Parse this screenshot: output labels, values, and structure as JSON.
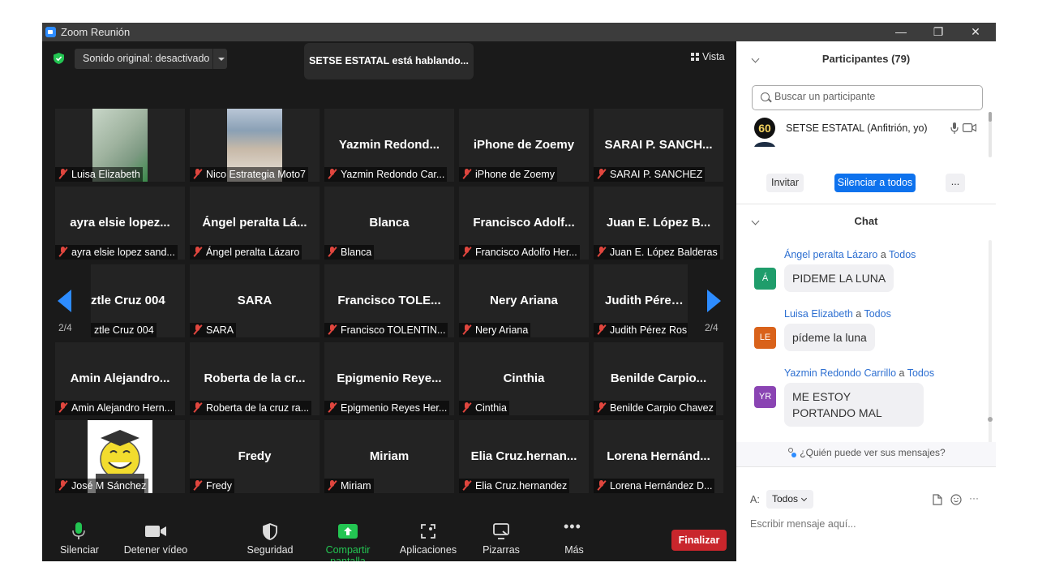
{
  "window": {
    "title": "Zoom Reunión",
    "minimize": "—",
    "restore": "❐",
    "close": "✕"
  },
  "top": {
    "audio_dropdown": "Sonido original: desactivado",
    "speaking_banner": "SETSE ESTATAL está hablando...",
    "view_label": "Vista"
  },
  "colors": {
    "accent_blue": "#2d8cff",
    "muted_red": "#e0463e",
    "end_red": "#c9262c",
    "share_green": "#23c552"
  },
  "grid": {
    "page_left": "2/4",
    "page_right": "2/4",
    "tiles": [
      {
        "name": "",
        "label": "Luisa Elizabeth"
      },
      {
        "name": "",
        "label": "Nico Estrategia Moto7"
      },
      {
        "name": "Yazmin  Redond...",
        "label": "Yazmin Redondo Car..."
      },
      {
        "name": "iPhone de Zoemy",
        "label": "iPhone de Zoemy"
      },
      {
        "name": "SARAI P. SANCH...",
        "label": "SARAI P. SANCHEZ"
      },
      {
        "name": "ayra elsie lopez...",
        "label": "ayra elsie lopez sand..."
      },
      {
        "name": "Ángel peralta Lá...",
        "label": "Ángel peralta Lázaro"
      },
      {
        "name": "Blanca",
        "label": "Blanca"
      },
      {
        "name": "Francisco  Adolf...",
        "label": "Francisco Adolfo Her..."
      },
      {
        "name": "Juan E. López B...",
        "label": "Juan E. López Balderas"
      },
      {
        "name": "ztle Cruz 004",
        "label": "ztle Cruz 004"
      },
      {
        "name": "SARA",
        "label": "SARA"
      },
      {
        "name": "Francisco  TOLE...",
        "label": "Francisco TOLENTIN..."
      },
      {
        "name": "Nery Ariana",
        "label": "Nery Ariana"
      },
      {
        "name": "Judith Pérez R",
        "label": "Judith Pérez Ros"
      },
      {
        "name": "Amin  Alejandro...",
        "label": "Amin Alejandro Hern..."
      },
      {
        "name": "Roberta de la cr...",
        "label": "Roberta de la cruz ra..."
      },
      {
        "name": "Epigmenio  Reye...",
        "label": "Epigmenio Reyes Her..."
      },
      {
        "name": "Cinthia",
        "label": "Cinthia"
      },
      {
        "name": "Benilde  Carpio...",
        "label": "Benilde Carpio Chavez"
      },
      {
        "name": "",
        "label": "José M Sánchez"
      },
      {
        "name": "Fredy",
        "label": "Fredy"
      },
      {
        "name": "Miriam",
        "label": "Miriam"
      },
      {
        "name": "Elia  Cruz.hernan...",
        "label": "Elia Cruz.hernandez"
      },
      {
        "name": "Lorena  Hernánd...",
        "label": "Lorena Hernández D..."
      }
    ]
  },
  "toolbar": {
    "mute": "Silenciar",
    "video": "Detener vídeo",
    "security": "Seguridad",
    "share": "Compartir pantalla",
    "apps": "Aplicaciones",
    "whiteboards": "Pizarras",
    "more": "Más",
    "end": "Finalizar"
  },
  "participants": {
    "title": "Participantes (79)",
    "search_placeholder": "Buscar un participante",
    "host_name": "SETSE ESTATAL (Anfitrión, yo)",
    "host_avatar": "60",
    "invite": "Invitar",
    "mute_all": "Silenciar a todos",
    "more": "..."
  },
  "chat": {
    "title": "Chat",
    "messages": [
      {
        "sender": "Ángel peralta Lázaro",
        "to": "a",
        "target": "Todos",
        "avatar": "Á",
        "avatar_color": "#1f9d6b",
        "text": "PIDEME LA LUNA"
      },
      {
        "sender": "Luisa Elizabeth",
        "to": "a",
        "target": "Todos",
        "avatar": "LE",
        "avatar_color": "#d9621a",
        "text": "pídeme la luna"
      },
      {
        "sender": "Yazmin Redondo Carrillo",
        "to": "a",
        "target": "Todos",
        "avatar": "YR",
        "avatar_color": "#8a44b3",
        "text": "ME ESTOY PORTANDO MAL"
      }
    ],
    "who_can_see": "¿Quién puede ver sus mensajes?",
    "to_label": "A:",
    "recipient": "Todos",
    "input_placeholder": "Escribir mensaje aquí..."
  }
}
